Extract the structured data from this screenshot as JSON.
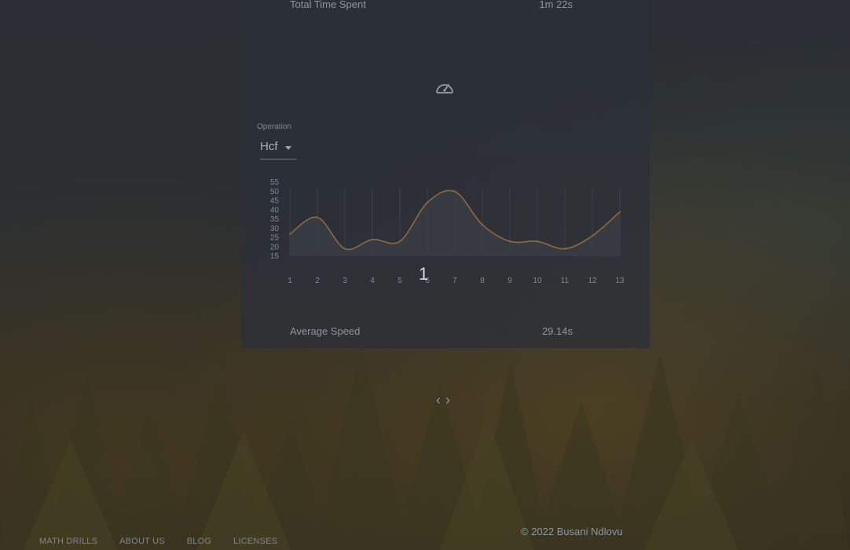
{
  "stats": {
    "total_time_label": "Total Time Spent",
    "total_time_value": "1m 22s",
    "average_speed_label": "Average Speed",
    "average_speed_value": "29.14s"
  },
  "speed_icon": "speedometer-icon",
  "operation": {
    "label": "Operation",
    "selected": "Hcf"
  },
  "pager": {
    "current_page": "1",
    "prev_icon": "chevron-left-icon",
    "next_icon": "chevron-right-icon"
  },
  "chart_data": {
    "type": "area",
    "x": [
      1,
      2,
      3,
      4,
      5,
      6,
      7,
      8,
      9,
      10,
      11,
      12,
      13
    ],
    "values": [
      27,
      36,
      19,
      24,
      23,
      44,
      50,
      32,
      23,
      23,
      19,
      26,
      39
    ],
    "ylim": [
      15,
      55
    ],
    "yticks": [
      55,
      50,
      45,
      40,
      35,
      30,
      25,
      20,
      15
    ],
    "grid": true,
    "colors": {
      "line": "#8a6a45",
      "fill": "#3a3d45"
    }
  },
  "footer": {
    "links": [
      "MATH DRILLS",
      "ABOUT US",
      "BLOG",
      "LICENSES"
    ],
    "copyright": "© 2022 Busani Ndlovu"
  }
}
